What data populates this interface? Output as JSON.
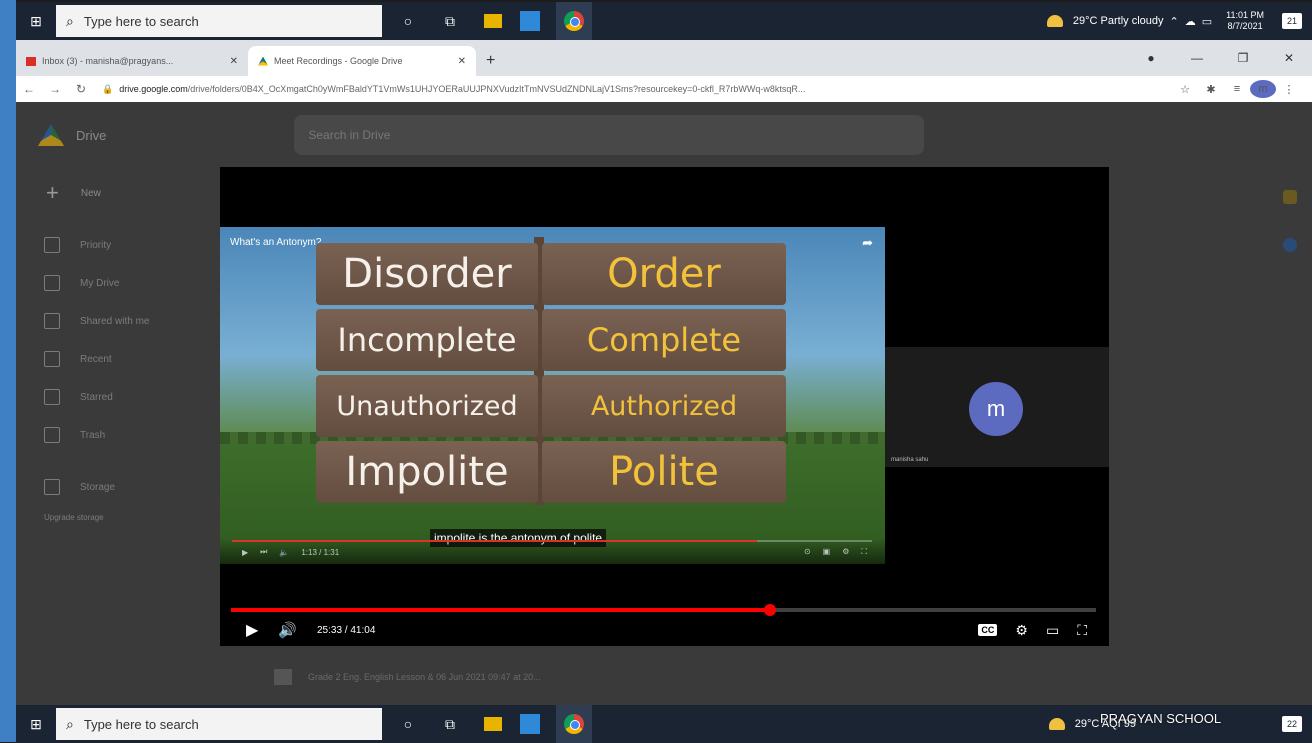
{
  "taskbar": {
    "search_placeholder": "Type here to search",
    "weather_top": "29°C Partly cloudy",
    "weather_bottom": "29°C AQI 99",
    "time": "11:01 PM",
    "date": "8/7/2021",
    "notifications_top": "21",
    "notifications_bottom": "22"
  },
  "browser": {
    "tabs": [
      {
        "label": "Inbox (3) - manisha@pragyans...",
        "icon": "gmail-icon",
        "active": false
      },
      {
        "label": "Meet Recordings - Google Drive",
        "icon": "drive-icon",
        "active": true
      }
    ],
    "url_host": "drive.google.com",
    "url_path": "/drive/folders/0B4X_OcXmgatCh0yWmFBaldYT1VmWs1UHJYOERaUUJPNXVudzItTmNVSUdZNDNLajV1Sms?resourcekey=0-ckfl_R7rbWWq-w8ktsqR..."
  },
  "drive": {
    "title": "Drive",
    "search_placeholder": "Search in Drive",
    "new_label": "New",
    "nav": [
      "Priority",
      "My Drive",
      "Shared with me",
      "Recent",
      "Starred",
      "Trash",
      "Storage"
    ],
    "storage_text": "Upgrade storage",
    "file_row": "Grade 2 Eng. English Lesson & 06 Jun 2021 09:47 at 20..."
  },
  "video": {
    "title": "What's an Antonym?",
    "words_left": [
      "Disorder",
      "Incomplete",
      "Unauthorized",
      "Impolite"
    ],
    "words_right": [
      "Order",
      "Complete",
      "Authorized",
      "Polite"
    ],
    "caption": "impolite is the antonym of polite",
    "inner_time": "1:13 / 1:31",
    "inner_progress": 0.82
  },
  "participant": {
    "initial": "m",
    "name": "manisha sahu"
  },
  "player": {
    "time": "25:33 / 41:04",
    "progress": 0.623
  },
  "watermark": "PRAGYAN SCHOOL"
}
